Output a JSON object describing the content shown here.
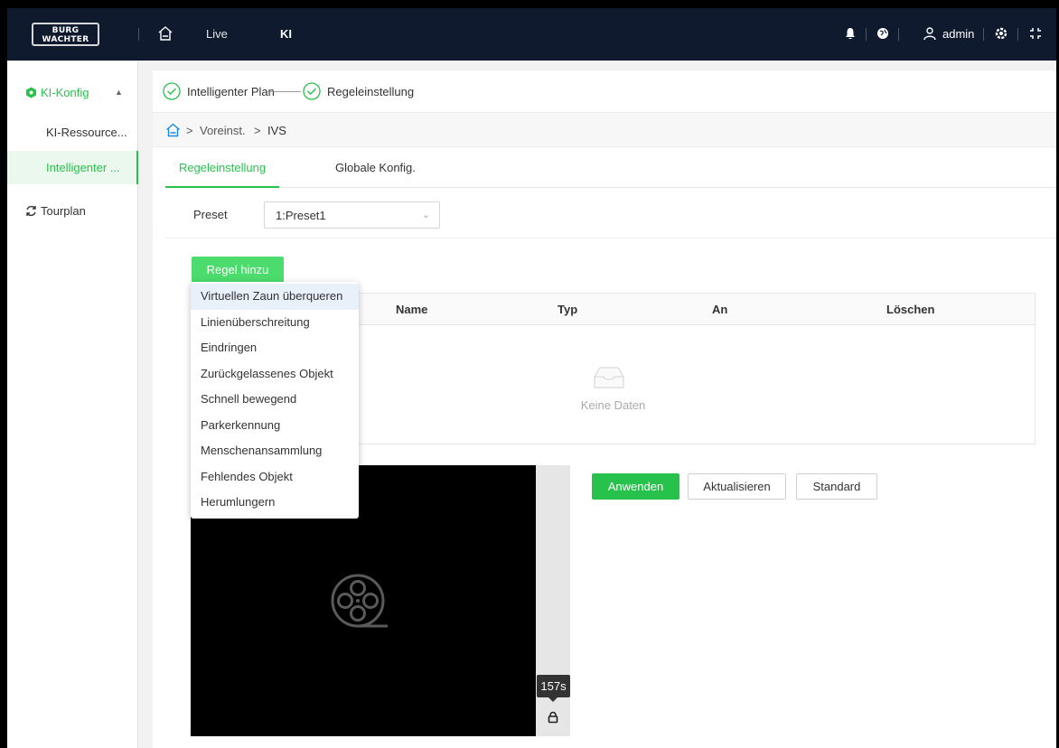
{
  "brand": {
    "line1": "BURG",
    "line2": "WACHTER"
  },
  "topnav": {
    "live": "Live",
    "ki": "KI",
    "user": "admin"
  },
  "sidebar": {
    "items": [
      {
        "label": "KI-Konfig",
        "icon": "ki-icon",
        "expanded": true
      },
      {
        "label": "KI-Ressource..."
      },
      {
        "label": "Intelligenter ...",
        "selected": true
      },
      {
        "label": "Tourplan",
        "icon": "refresh-icon"
      }
    ]
  },
  "steps": [
    {
      "label": "Intelligenter Plan",
      "done": true
    },
    {
      "label": "Regeleinstellung",
      "done": true
    }
  ],
  "breadcrumb": {
    "sep1": ">",
    "item1": "Voreinst.",
    "sep2": ">",
    "item2": "IVS"
  },
  "tabs": [
    {
      "label": "Regeleinstellung",
      "active": true
    },
    {
      "label": "Globale Konfig."
    }
  ],
  "preset": {
    "label": "Preset",
    "value": "1:Preset1"
  },
  "add_rule_label": "Regel hinzu",
  "table": {
    "columns": [
      "Name",
      "Typ",
      "An",
      "Löschen"
    ],
    "empty_text": "Keine Daten"
  },
  "video": {
    "timer": "157s"
  },
  "actions": {
    "apply": "Anwenden",
    "refresh": "Aktualisieren",
    "default": "Standard"
  },
  "rule_menu": [
    "Virtuellen Zaun überqueren",
    "Linienüberschreitung",
    "Eindringen",
    "Zurückgelassenes Objekt",
    "Schnell bewegend",
    "Parkerkennung",
    "Menschenansammlung",
    "Fehlendes Objekt",
    "Herumlungern"
  ],
  "colors": {
    "accent": "#27c24c",
    "topbar": "#0f1a2e",
    "button_green": "#4cdc6d"
  }
}
